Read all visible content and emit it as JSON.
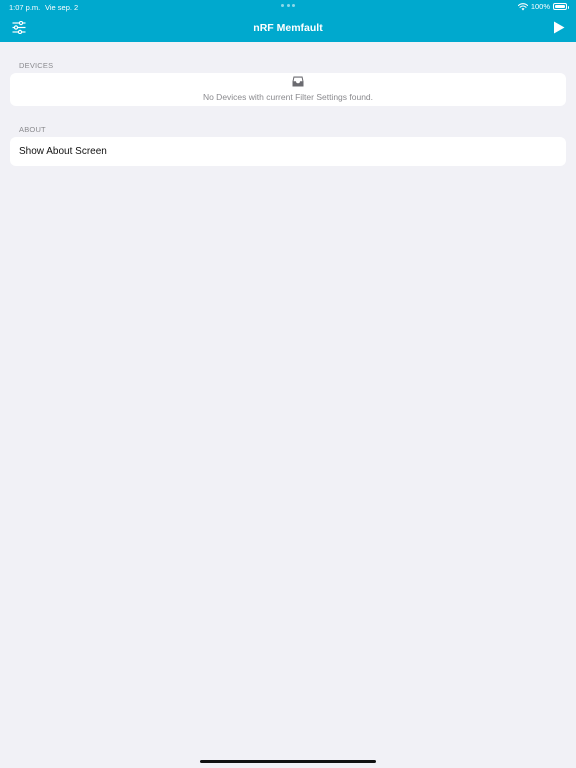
{
  "status_bar": {
    "time": "1:07 p.m.",
    "date": "Vie sep. 2",
    "battery": "100%"
  },
  "nav": {
    "title": "nRF Memfault",
    "filter_icon": "sliders-icon",
    "play_icon": "play-icon",
    "bar_color": "#00a9ce"
  },
  "devices": {
    "header": "DEVICES",
    "empty_icon": "tray-icon",
    "empty_message": "No Devices with current Filter Settings found."
  },
  "about": {
    "header": "ABOUT",
    "item_label": "Show About Screen"
  }
}
